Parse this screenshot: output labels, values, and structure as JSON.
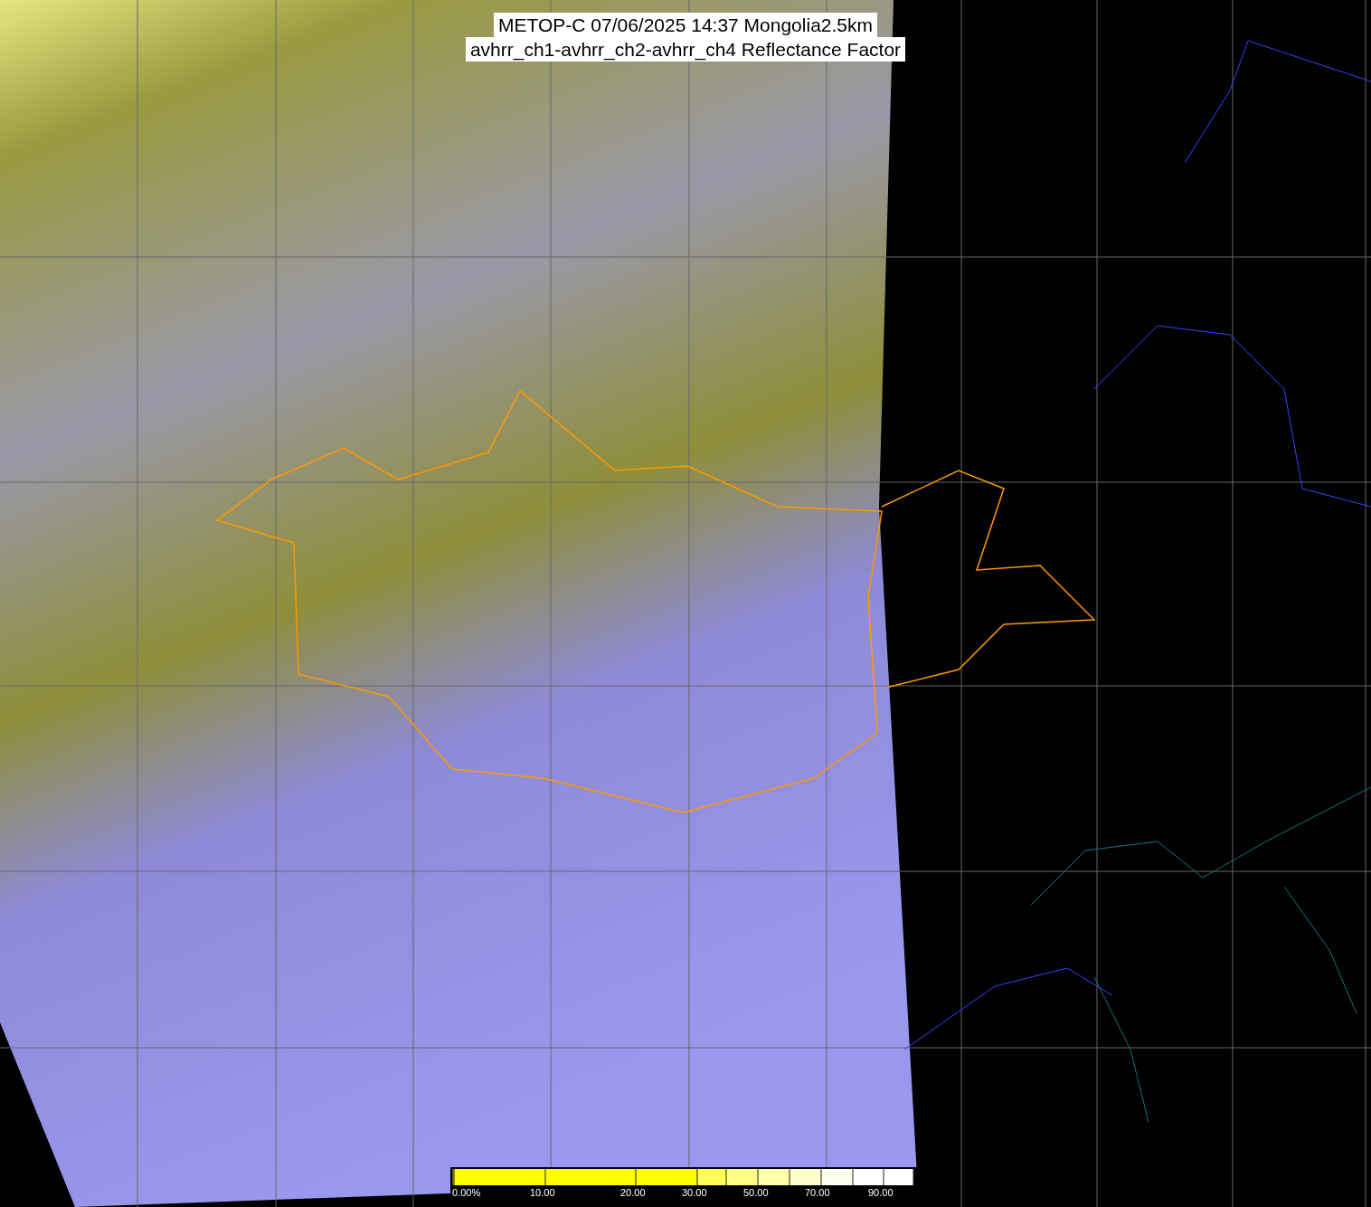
{
  "title": {
    "lines": [
      "METOP-C 07/06/2025 14:37 Mongolia2.5km",
      "avhrr_ch1-avhrr_ch2-avhrr_ch4 Reflectance Factor"
    ]
  },
  "colorbar": {
    "labels": [
      "0.00%",
      "10.00",
      "20.00",
      "30.00",
      "50.00",
      "70.00",
      "90.00"
    ]
  }
}
